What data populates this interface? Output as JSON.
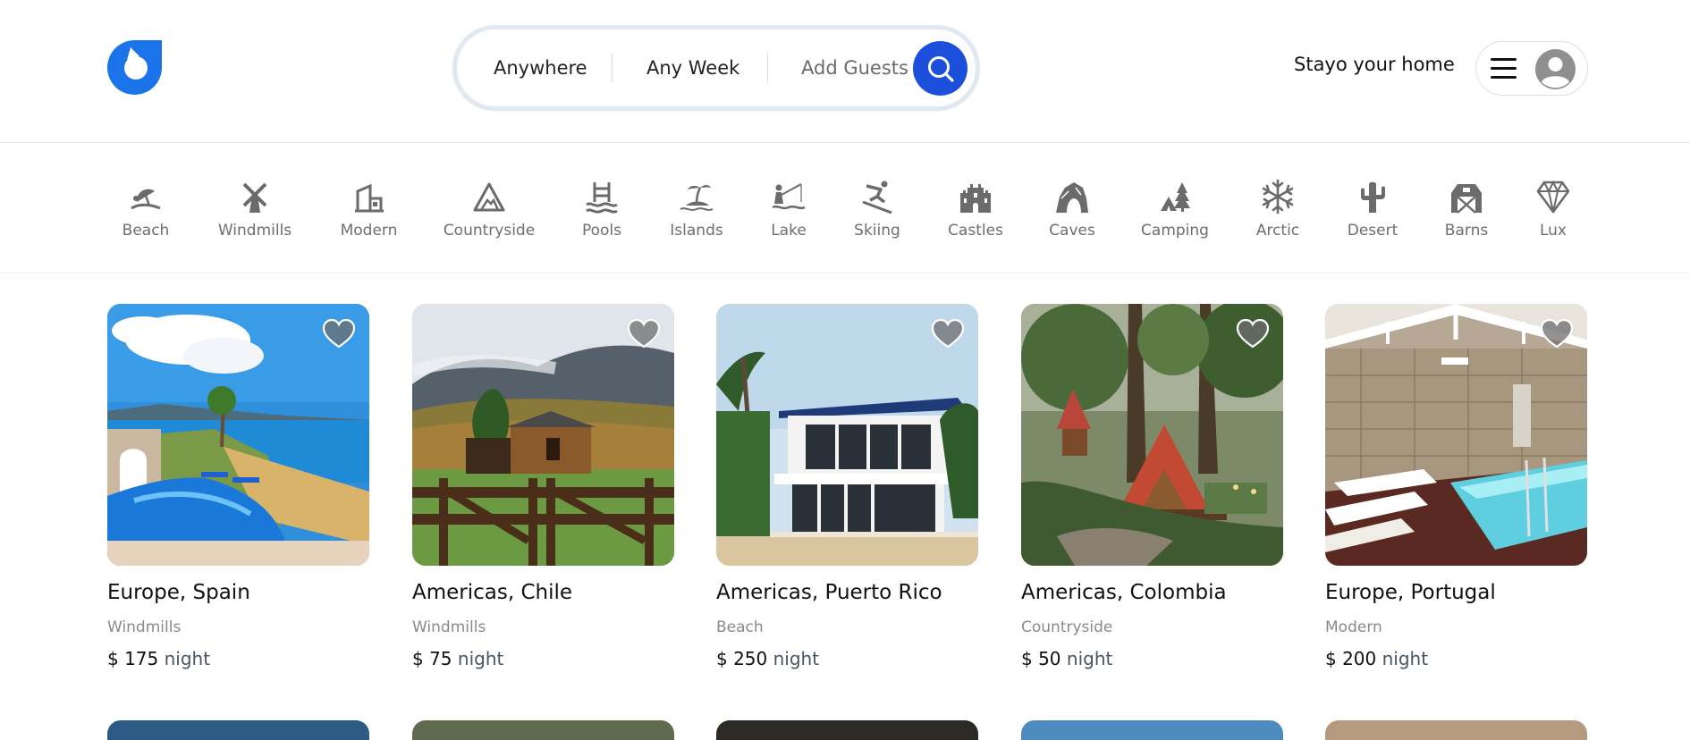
{
  "header": {
    "logo_icon": "droplet-logo-icon",
    "search": {
      "anywhere": "Anywhere",
      "any_week": "Any Week",
      "add_guests": "Add Guests",
      "button_icon": "search-icon"
    },
    "host_link": "Stayo your home",
    "menu_icon": "hamburger-menu-icon",
    "avatar_icon": "user-avatar-icon"
  },
  "categories": [
    {
      "label": "Beach",
      "icon": "beach-icon"
    },
    {
      "label": "Windmills",
      "icon": "windmill-icon"
    },
    {
      "label": "Modern",
      "icon": "modern-building-icon"
    },
    {
      "label": "Countryside",
      "icon": "mountain-icon"
    },
    {
      "label": "Pools",
      "icon": "pool-icon"
    },
    {
      "label": "Islands",
      "icon": "island-icon"
    },
    {
      "label": "Lake",
      "icon": "lake-icon"
    },
    {
      "label": "Skiing",
      "icon": "skiing-icon"
    },
    {
      "label": "Castles",
      "icon": "castle-icon"
    },
    {
      "label": "Caves",
      "icon": "cave-icon"
    },
    {
      "label": "Camping",
      "icon": "camping-icon"
    },
    {
      "label": "Arctic",
      "icon": "snowflake-icon"
    },
    {
      "label": "Desert",
      "icon": "cactus-icon"
    },
    {
      "label": "Barns",
      "icon": "barn-icon"
    },
    {
      "label": "Lux",
      "icon": "diamond-icon"
    }
  ],
  "listings": [
    {
      "location": "Europe, Spain",
      "category": "Windmills",
      "price": "$ 175",
      "unit": "night"
    },
    {
      "location": "Americas, Chile",
      "category": "Windmills",
      "price": "$ 75",
      "unit": "night"
    },
    {
      "location": "Americas, Puerto Rico",
      "category": "Beach",
      "price": "$ 250",
      "unit": "night"
    },
    {
      "location": "Americas, Colombia",
      "category": "Countryside",
      "price": "$ 50",
      "unit": "night"
    },
    {
      "location": "Europe, Portugal",
      "category": "Modern",
      "price": "$ 200",
      "unit": "night"
    }
  ],
  "colors": {
    "brand": "#1a73e8",
    "search_button": "#1b4fdc",
    "icon_gray": "#6b6b6b",
    "text_muted": "#8a8a8a"
  }
}
